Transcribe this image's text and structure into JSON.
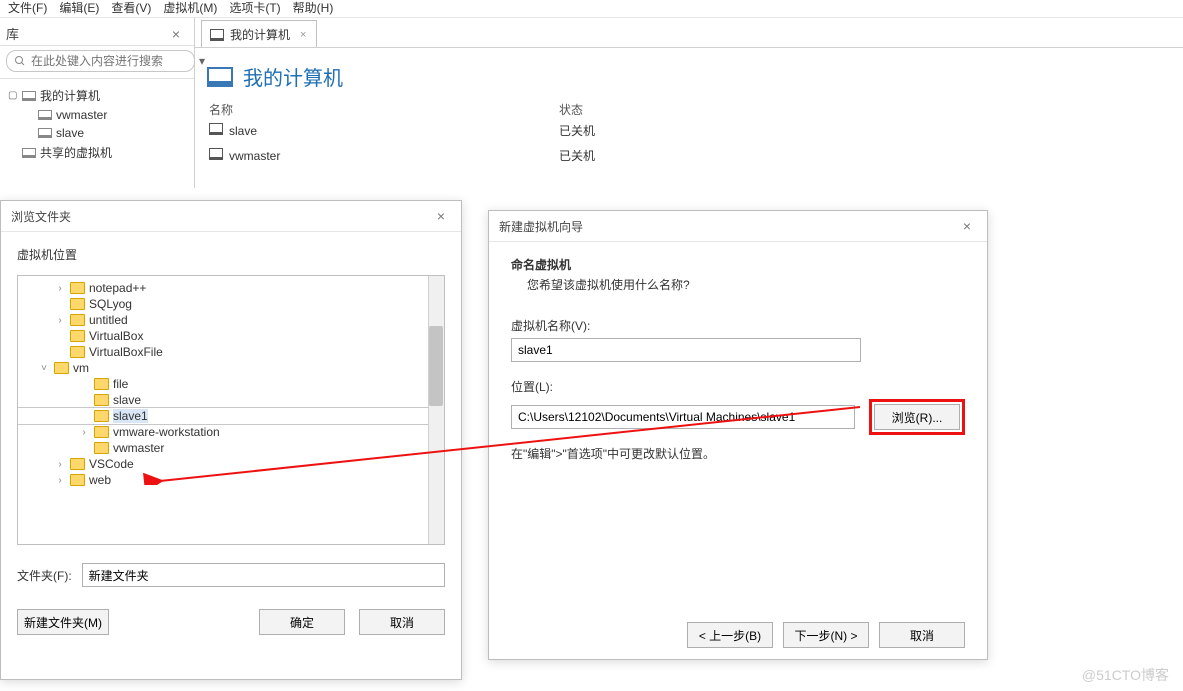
{
  "menubar": {
    "items": [
      "文件(F)",
      "编辑(E)",
      "查看(V)",
      "虚拟机(M)",
      "选项卡(T)",
      "帮助(H)"
    ]
  },
  "sidebar": {
    "lib_title": "库",
    "search_placeholder": "在此处键入内容进行搜索",
    "tree": {
      "root": "我的计算机",
      "items": [
        "vwmaster",
        "slave"
      ],
      "shared": "共享的虚拟机"
    }
  },
  "main": {
    "tab_label": "我的计算机",
    "big_title": "我的计算机",
    "columns": {
      "name": "名称",
      "state": "状态"
    },
    "rows": [
      {
        "name": "slave",
        "state": "已关机"
      },
      {
        "name": "vwmaster",
        "state": "已关机"
      }
    ]
  },
  "browse_dialog": {
    "title": "浏览文件夹",
    "section_label": "虚拟机位置",
    "folders": [
      {
        "name": "notepad++",
        "exp": ">",
        "indent": 36
      },
      {
        "name": "SQLyog",
        "exp": "",
        "indent": 36
      },
      {
        "name": "untitled",
        "exp": ">",
        "indent": 36
      },
      {
        "name": "VirtualBox",
        "exp": "",
        "indent": 36
      },
      {
        "name": "VirtualBoxFile",
        "exp": "",
        "indent": 36
      },
      {
        "name": "vm",
        "exp": "v",
        "indent": 20
      },
      {
        "name": "file",
        "exp": "",
        "indent": 60
      },
      {
        "name": "slave",
        "exp": "",
        "indent": 60
      },
      {
        "name": "slave1",
        "exp": "",
        "indent": 60,
        "selected": true
      },
      {
        "name": "vmware-workstation",
        "exp": ">",
        "indent": 60
      },
      {
        "name": "vwmaster",
        "exp": "",
        "indent": 60
      },
      {
        "name": "VSCode",
        "exp": ">",
        "indent": 36
      },
      {
        "name": "web",
        "exp": ">",
        "indent": 36
      }
    ],
    "folder_field_label": "文件夹(F):",
    "folder_field_value": "新建文件夹",
    "btn_newfolder": "新建文件夹(M)",
    "btn_ok": "确定",
    "btn_cancel": "取消"
  },
  "wizard_dialog": {
    "title": "新建虚拟机向导",
    "head_strong": "命名虚拟机",
    "head_sub": "您希望该虚拟机使用什么名称?",
    "vm_name_label": "虚拟机名称(V):",
    "vm_name_value": "slave1",
    "location_label": "位置(L):",
    "location_value": "C:\\Users\\12102\\Documents\\Virtual Machines\\slave1",
    "browse_btn": "浏览(R)...",
    "note": "在\"编辑\">\"首选项\"中可更改默认位置。",
    "btn_back": "< 上一步(B)",
    "btn_next": "下一步(N) >",
    "btn_cancel": "取消"
  },
  "watermark": "@51CTO博客"
}
